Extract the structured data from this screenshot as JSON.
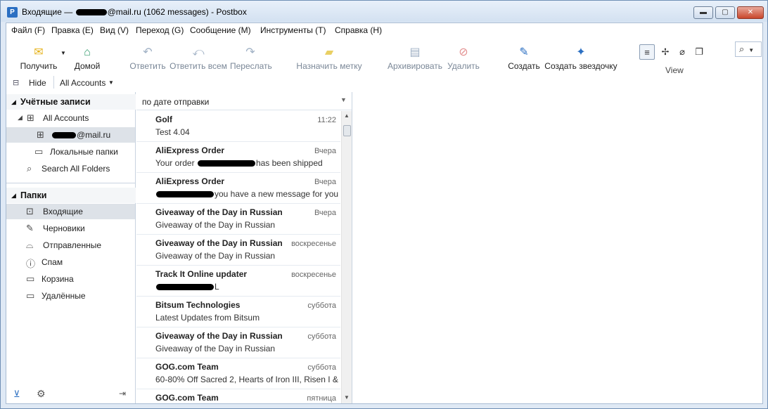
{
  "window": {
    "title_prefix": "Входящие — ",
    "title_suffix": "@mail.ru (1062 messages) - Postbox",
    "app_icon": "postbox-icon",
    "controls": {
      "minimize": "▬",
      "maximize": "▢",
      "close": "✕"
    }
  },
  "menu": [
    {
      "label": "Файл (F)"
    },
    {
      "label": "Правка (E)"
    },
    {
      "label": "Вид (V)"
    },
    {
      "label": "Переход (G)"
    },
    {
      "label": "Сообщение (M)"
    },
    {
      "label": "Инструменты (T)"
    },
    {
      "label": "Справка (H)"
    }
  ],
  "toolbar": {
    "get": {
      "label": "Получить",
      "icon": "envelope-download-icon"
    },
    "home": {
      "label": "Домой",
      "icon": "home-icon"
    },
    "reply": {
      "label": "Ответить",
      "icon": "reply-icon"
    },
    "reply_all": {
      "label": "Ответить всем",
      "icon": "reply-all-icon"
    },
    "forward": {
      "label": "Переслать",
      "icon": "forward-icon"
    },
    "tag": {
      "label": "Назначить метку",
      "icon": "tag-icon"
    },
    "archive": {
      "label": "Архивировать",
      "icon": "archive-icon"
    },
    "delete": {
      "label": "Удалить",
      "icon": "delete-icon"
    },
    "compose": {
      "label": "Создать",
      "icon": "compose-icon"
    },
    "compose_star": {
      "label": "Создать звездочку",
      "icon": "pin-icon"
    },
    "view_label": "View"
  },
  "hidebar": {
    "hide_label": "Hide",
    "accounts_select": "All Accounts"
  },
  "sidebar": {
    "accounts_header": "Учётные записи",
    "all_accounts": "All Accounts",
    "account_suffix": "@mail.ru",
    "local_folders": "Локальные папки",
    "search_all": "Search All Folders",
    "folders_header": "Папки",
    "folders": [
      {
        "label": "Входящие",
        "icon": "inbox-icon"
      },
      {
        "label": "Черновики",
        "icon": "drafts-icon"
      },
      {
        "label": "Отправленные",
        "icon": "sent-icon"
      },
      {
        "label": "Спам",
        "icon": "spam-icon"
      },
      {
        "label": "Корзина",
        "icon": "trash-folder-icon"
      },
      {
        "label": "Удалённые",
        "icon": "deleted-folder-icon"
      }
    ]
  },
  "messages": {
    "sort_label": "по дате отправки",
    "rows": [
      {
        "from": "Golf",
        "date": "11:22",
        "subject": "Test 4.04"
      },
      {
        "from": "AliExpress Order",
        "date": "Вчера",
        "subject": "Your order ",
        "subject_tail": "has been shipped",
        "redacted": true
      },
      {
        "from": "AliExpress Order",
        "date": "Вчера",
        "subject": "",
        "subject_tail": "you have a new message for you...",
        "redacted": true
      },
      {
        "from": "Giveaway of the Day in Russian",
        "date": "Вчера",
        "subject": "Giveaway of the Day in Russian"
      },
      {
        "from": "Giveaway of the Day in Russian",
        "date": "воскресенье",
        "subject": "Giveaway of the Day in Russian"
      },
      {
        "from": "Track It Online updater",
        "date": "воскресенье",
        "subject": "",
        "subject_tail": "L",
        "redacted": true
      },
      {
        "from": "Bitsum Technologies",
        "date": "суббота",
        "subject": "Latest Updates from Bitsum"
      },
      {
        "from": "Giveaway of the Day in Russian",
        "date": "суббота",
        "subject": "Giveaway of the Day in Russian"
      },
      {
        "from": "GOG.com Team",
        "date": "суббота",
        "subject": "60-80% Off Sacred 2, Hearts of Iron III, Risen I &..."
      },
      {
        "from": "GOG.com Team",
        "date": "пятница",
        "subject": ""
      }
    ]
  }
}
